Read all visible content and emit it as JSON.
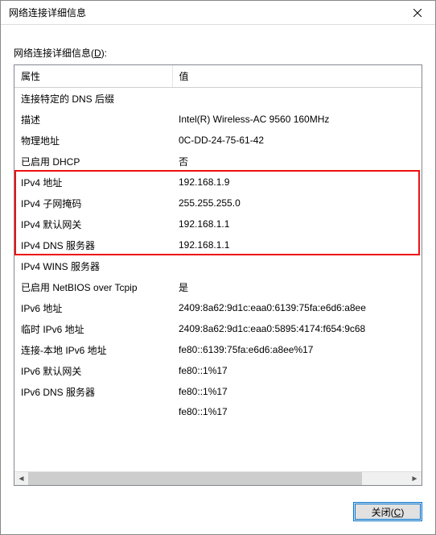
{
  "window": {
    "title": "网络连接详细信息"
  },
  "section_label": {
    "text": "网络连接详细信息",
    "accel": "(D)",
    "accel_key": "D"
  },
  "columns": {
    "property": "属性",
    "value": "值"
  },
  "rows": [
    {
      "property": "连接特定的 DNS 后缀",
      "value": "",
      "hl": false
    },
    {
      "property": "描述",
      "value": "Intel(R) Wireless-AC 9560 160MHz",
      "hl": false
    },
    {
      "property": "物理地址",
      "value": "0C-DD-24-75-61-42",
      "hl": false
    },
    {
      "property": "已启用 DHCP",
      "value": "否",
      "hl": false
    },
    {
      "property": "IPv4 地址",
      "value": "192.168.1.9",
      "hl": true
    },
    {
      "property": "IPv4 子网掩码",
      "value": "255.255.255.0",
      "hl": true
    },
    {
      "property": "IPv4 默认网关",
      "value": "192.168.1.1",
      "hl": true
    },
    {
      "property": "IPv4 DNS 服务器",
      "value": "192.168.1.1",
      "hl": true
    },
    {
      "property": "IPv4 WINS 服务器",
      "value": "",
      "hl": false
    },
    {
      "property": "已启用 NetBIOS over Tcpip",
      "value": "是",
      "hl": false
    },
    {
      "property": "IPv6 地址",
      "value": "2409:8a62:9d1c:eaa0:6139:75fa:e6d6:a8ee",
      "hl": false
    },
    {
      "property": "临时 IPv6 地址",
      "value": "2409:8a62:9d1c:eaa0:5895:4174:f654:9c68",
      "hl": false
    },
    {
      "property": "连接-本地 IPv6 地址",
      "value": "fe80::6139:75fa:e6d6:a8ee%17",
      "hl": false
    },
    {
      "property": "IPv6 默认网关",
      "value": "fe80::1%17",
      "hl": false
    },
    {
      "property": "IPv6 DNS 服务器",
      "value": "fe80::1%17",
      "hl": false
    },
    {
      "property": "",
      "value": "fe80::1%17",
      "hl": false
    }
  ],
  "buttons": {
    "close_label": "关闭",
    "close_accel": "(C)"
  },
  "highlight": {
    "color": "#e11"
  }
}
